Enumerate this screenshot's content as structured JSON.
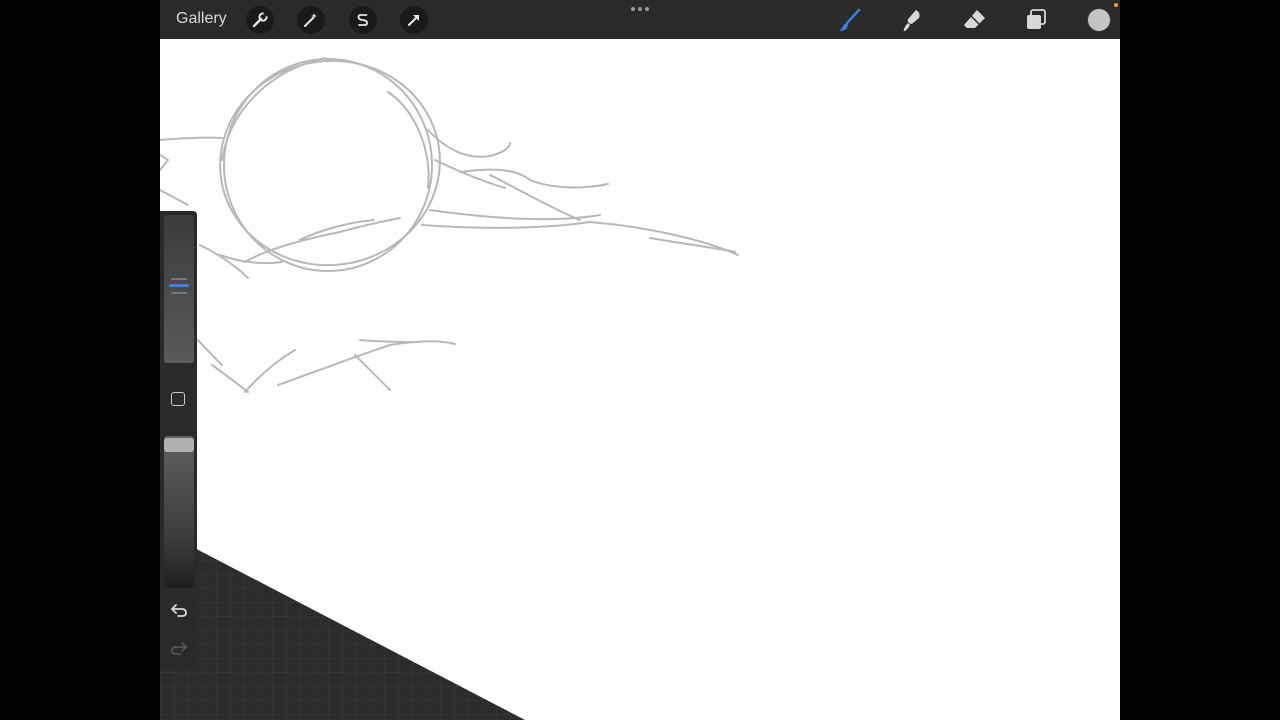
{
  "topbar": {
    "gallery_label": "Gallery",
    "left_tools": [
      {
        "name": "actions",
        "icon": "wrench-icon"
      },
      {
        "name": "adjustments",
        "icon": "magic-wand-icon"
      },
      {
        "name": "selection",
        "icon": "selection-s-icon"
      },
      {
        "name": "transform",
        "icon": "arrow-cursor-icon"
      }
    ],
    "more_icon": "more-dots-icon",
    "right_tools": [
      {
        "name": "paint",
        "icon": "brush-icon",
        "active": true
      },
      {
        "name": "smudge",
        "icon": "smudge-icon",
        "active": false
      },
      {
        "name": "erase",
        "icon": "eraser-icon",
        "active": false
      },
      {
        "name": "layers",
        "icon": "layers-icon",
        "active": false
      }
    ],
    "current_color": "#c4c4c4",
    "status_dot_color": "#f2a33a"
  },
  "sidebar": {
    "brush_size": 0.52,
    "brush_opacity": 1.0,
    "modify_icon": "modify-square-icon",
    "undo_icon": "undo-icon",
    "redo_icon": "redo-icon"
  },
  "colors": {
    "toolbar_bg": "#2a2a2a",
    "accent": "#3b7de0",
    "canvas": "#ffffff",
    "sketch_stroke": "#b8b8b8"
  }
}
